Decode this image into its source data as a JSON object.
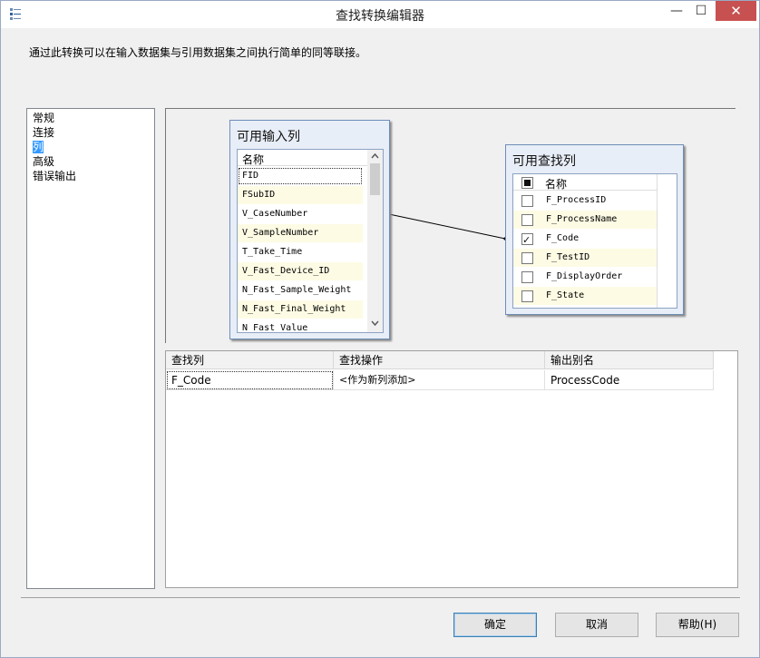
{
  "window": {
    "title": "查找转换编辑器",
    "minimize_glyph": "—",
    "maximize_glyph": "☐",
    "close_glyph": "✕"
  },
  "description": "通过此转换可以在输入数据集与引用数据集之间执行简单的同等联接。",
  "nav": {
    "items": [
      "常规",
      "连接",
      "列",
      "高级",
      "错误输出"
    ],
    "selected": "列"
  },
  "input_columns": {
    "title": "可用输入列",
    "header": "名称",
    "rows": [
      "FID",
      "FSubID",
      "V_CaseNumber",
      "V_SampleNumber",
      "T_Take_Time",
      "V_Fast_Device_ID",
      "N_Fast_Sample_Weight",
      "N_Fast_Final_Weight",
      "N_Fast_Value"
    ]
  },
  "lookup_columns": {
    "title": "可用查找列",
    "header": "名称",
    "rows": [
      {
        "name": "F_ProcessID",
        "checked": false
      },
      {
        "name": "F_ProcessName",
        "checked": false
      },
      {
        "name": "F_Code",
        "checked": true
      },
      {
        "name": "F_TestID",
        "checked": false
      },
      {
        "name": "F_DisplayOrder",
        "checked": false
      },
      {
        "name": "F_State",
        "checked": false
      }
    ]
  },
  "mapping_grid": {
    "headers": [
      "查找列",
      "查找操作",
      "输出别名"
    ],
    "rows": [
      [
        "F_Code",
        "<作为新列添加>",
        "ProcessCode"
      ]
    ]
  },
  "buttons": {
    "ok": "确定",
    "cancel": "取消",
    "help": "帮助(H)"
  }
}
